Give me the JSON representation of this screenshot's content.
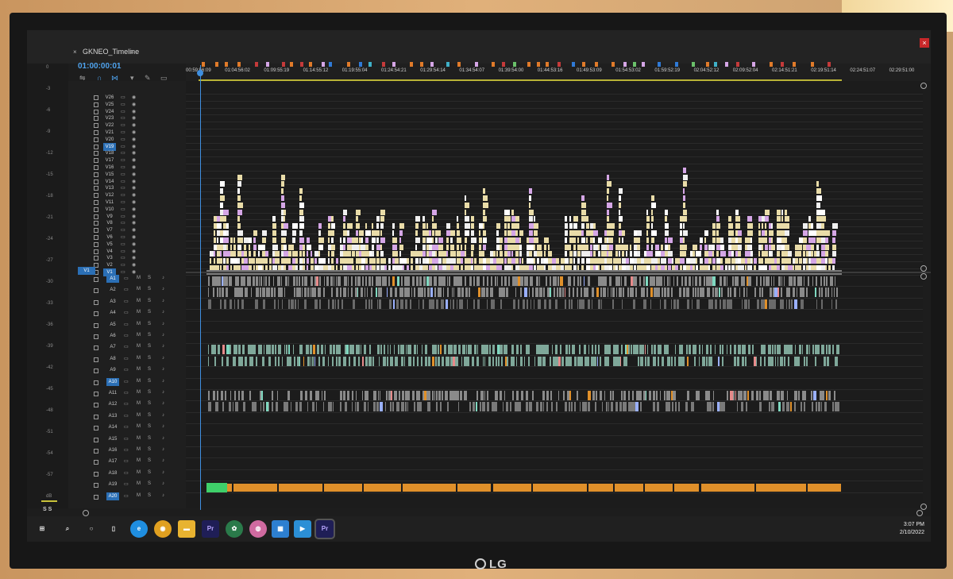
{
  "panel": {
    "tab_title": "GKNEO_Timeline",
    "close_glyph": "×",
    "menu_glyph": "≡",
    "window_close": "×"
  },
  "timecode": "01:00:00:01",
  "ruler_labels": [
    "00:59:56:09",
    "01:04:56:02",
    "01:09:55:19",
    "01:14:55:12",
    "01:19:55:04",
    "01:24:54:21",
    "01:29:54:14",
    "01:34:54:07",
    "01:39:54:00",
    "01:44:53:16",
    "01:49:53:09",
    "01:54:53:02",
    "01:59:52:19",
    "02:04:52:12",
    "02:09:52:04",
    "02:14:51:21",
    "02:19:51:14",
    "02:24:51:07",
    "02:29:51:00"
  ],
  "left_ticks": [
    "0",
    "-3",
    "-6",
    "-9",
    "-12",
    "-15",
    "-18",
    "-21",
    "-24",
    "-27",
    "-30",
    "-33",
    "-36",
    "-39",
    "-42",
    "-45",
    "-48",
    "-51",
    "-54",
    "-57",
    "dB"
  ],
  "meter_labels": [
    "S",
    "S"
  ],
  "video_tracks": [
    "V26",
    "V25",
    "V24",
    "V23",
    "V22",
    "V21",
    "V20",
    "V19",
    "V18",
    "V17",
    "V16",
    "V15",
    "V14",
    "V13",
    "V12",
    "V11",
    "V10",
    "V9",
    "V8",
    "V7",
    "V6",
    "V5",
    "V4",
    "V3",
    "V2",
    "V1"
  ],
  "audio_tracks": [
    "A1",
    "A2",
    "A3",
    "A4",
    "A5",
    "A6",
    "A7",
    "A8",
    "A9",
    "A10",
    "A11",
    "A12",
    "A13",
    "A14",
    "A15",
    "A16",
    "A17",
    "A18",
    "A19",
    "A20"
  ],
  "source_patch": {
    "video": "V1"
  },
  "selected_tracks": [
    "V19",
    "V1",
    "A1",
    "A10",
    "A20"
  ],
  "track_buttons": {
    "mute": "M",
    "solo": "S"
  },
  "taskbar": {
    "apps": [
      "windows-start",
      "search",
      "cortana",
      "task-view",
      "edge",
      "chrome",
      "file-explorer",
      "premiere-pro",
      "app-green",
      "app-pink",
      "app-blue-calendar",
      "app-media",
      "premiere-pro-active"
    ],
    "premiere_label": "Pr",
    "time": "3:07 PM",
    "date": "2/10/2022"
  },
  "brand": "LG",
  "colors": {
    "accent_blue": "#3f8fe0",
    "clip_yellow": "#e9dca8",
    "clip_pink": "#d5a6e6",
    "clip_teal": "#7fd8c0",
    "clip_orange": "#e0902a",
    "clip_gray": "#8a8a8a"
  }
}
